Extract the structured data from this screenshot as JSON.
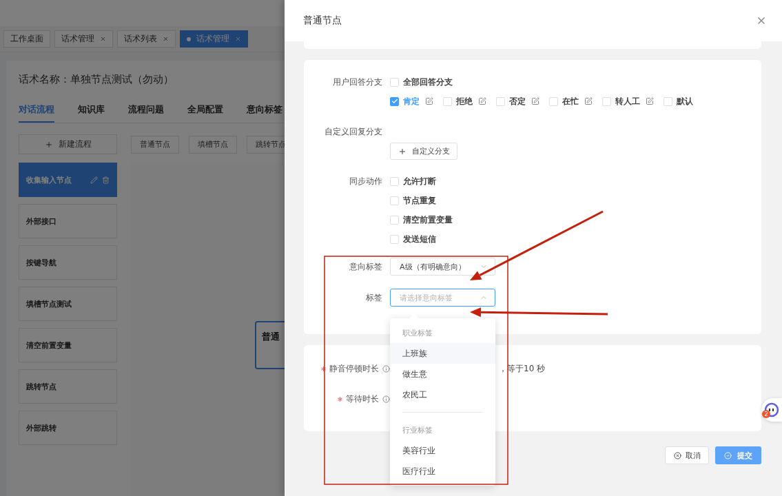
{
  "background": {
    "tabs": [
      {
        "label": "工作桌面",
        "closable": false,
        "selected": false
      },
      {
        "label": "话术管理",
        "closable": true,
        "selected": false
      },
      {
        "label": "话术列表",
        "closable": true,
        "selected": false
      },
      {
        "label": "话术管理",
        "closable": true,
        "selected": true
      }
    ],
    "script_name": "话术名称：单独节点测试（勿动）",
    "nav_tabs": [
      {
        "label": "对话流程",
        "selected": true
      },
      {
        "label": "知识库",
        "selected": false
      },
      {
        "label": "流程问题",
        "selected": false
      },
      {
        "label": "全局配置",
        "selected": false
      },
      {
        "label": "意向标签",
        "selected": false
      }
    ],
    "new_flow_button": "新建流程",
    "node_buttons": [
      "普通节点",
      "填槽节点",
      "跳转节点"
    ],
    "flows": [
      {
        "label": "收集输入节点",
        "selected": true
      },
      {
        "label": "外部接口",
        "selected": false
      },
      {
        "label": "按键导航",
        "selected": false
      },
      {
        "label": "填槽节点测试",
        "selected": false
      },
      {
        "label": "清空前置变量",
        "selected": false
      },
      {
        "label": "跳转节点",
        "selected": false
      },
      {
        "label": "外部跳转",
        "selected": false
      }
    ],
    "canvas_node": "普通"
  },
  "drawer": {
    "title": "普通节点",
    "answer_branches": {
      "label": "用户回答分支",
      "all": {
        "label": "全部回答分支",
        "checked": false
      },
      "options": [
        {
          "label": "肯定",
          "checked": true,
          "editable": true
        },
        {
          "label": "拒绝",
          "checked": false,
          "editable": true
        },
        {
          "label": "否定",
          "checked": false,
          "editable": true
        },
        {
          "label": "在忙",
          "checked": false,
          "editable": true
        },
        {
          "label": "转人工",
          "checked": false,
          "editable": true
        },
        {
          "label": "默认",
          "checked": false,
          "editable": false
        }
      ]
    },
    "custom_branch": {
      "label": "自定义回复分支",
      "button": "自定义分支"
    },
    "sync_actions": {
      "label": "同步动作",
      "options": [
        {
          "label": "允许打断",
          "checked": false
        },
        {
          "label": "节点重复",
          "checked": false
        },
        {
          "label": "清空前置变量",
          "checked": false
        },
        {
          "label": "发送短信",
          "checked": false
        }
      ]
    },
    "intent_tag": {
      "label": "意向标签",
      "value": "A级（有明确意向）"
    },
    "tag": {
      "label": "标签",
      "placeholder": "请选择意向标签",
      "open": true
    },
    "dropdown": {
      "groups": [
        {
          "title": "职业标签",
          "items": [
            {
              "label": "上班族",
              "selected": true
            },
            {
              "label": "做生意",
              "selected": false
            },
            {
              "label": "农民工",
              "selected": false
            }
          ]
        },
        {
          "title": "行业标签",
          "items": [
            {
              "label": "美容行业",
              "selected": false
            },
            {
              "label": "医疗行业",
              "selected": false
            }
          ]
        }
      ]
    },
    "timing": [
      {
        "label": "静音停顿时长",
        "required": true,
        "suffix": "，等于10 秒"
      },
      {
        "label": "等待时长",
        "required": true
      }
    ],
    "buttons": {
      "cancel": "取消",
      "submit": "提交"
    }
  },
  "chat_widget": {
    "badge": "2"
  }
}
